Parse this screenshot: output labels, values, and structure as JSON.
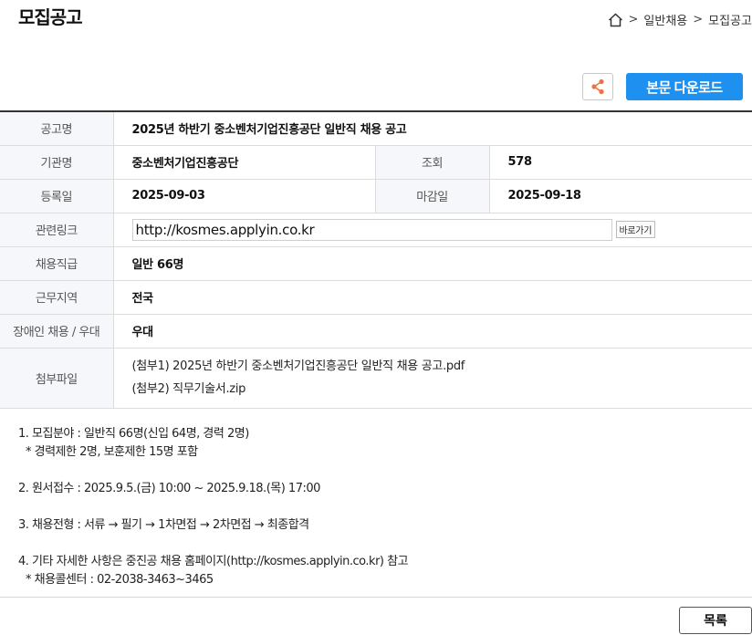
{
  "page": {
    "title": "모집공고"
  },
  "breadcrumb": {
    "sep": ">",
    "items": [
      "일반채용",
      "모집공고"
    ]
  },
  "actions": {
    "download_label": "본문 다운로드"
  },
  "info": {
    "title_label": "공고명",
    "title_value": "2025년 하반기 중소벤처기업진흥공단 일반직 채용 공고",
    "org_label": "기관명",
    "org_value": "중소벤처기업진흥공단",
    "views_label": "조회",
    "views_value": "578",
    "reg_label": "등록일",
    "reg_value": "2025-09-03",
    "deadline_label": "마감일",
    "deadline_value": "2025-09-18",
    "link_label": "관련링크",
    "link_value": "http://kosmes.applyin.co.kr",
    "go_label": "바로가기",
    "grade_label": "채용직급",
    "grade_value": "일반 66명",
    "region_label": "근무지역",
    "region_value": "전국",
    "disability_label": "장애인 채용 / 우대",
    "disability_value": "우대",
    "files_label": "첨부파일",
    "files": [
      "(첨부1) 2025년 하반기 중소벤처기업진흥공단 일반직 채용 공고.pdf",
      "(첨부2) 직무기술서.zip"
    ]
  },
  "content": {
    "p1_l1": "1. 모집분야 : 일반직 66명(신입 64명, 경력 2명)",
    "p1_l2": "* 경력제한 2명, 보훈제한 15명 포함",
    "p2": "2. 원서접수 : 2025.9.5.(금) 10:00 ~ 2025.9.18.(목) 17:00",
    "p3": "3. 채용전형 : 서류 → 필기 → 1차면접 → 2차면접 → 최종합격",
    "p4_l1": "4. 기타 자세한 사항은 중진공 채용 홈페이지(http://kosmes.applyin.co.kr) 참고",
    "p4_l2": "* 채용콜센터 : 02-2038-3463~3465"
  },
  "footer": {
    "list_label": "목록"
  },
  "colors": {
    "accent": "#1e90f0",
    "share_icon": "#f07040",
    "header_cell": "#f5f7fa"
  }
}
